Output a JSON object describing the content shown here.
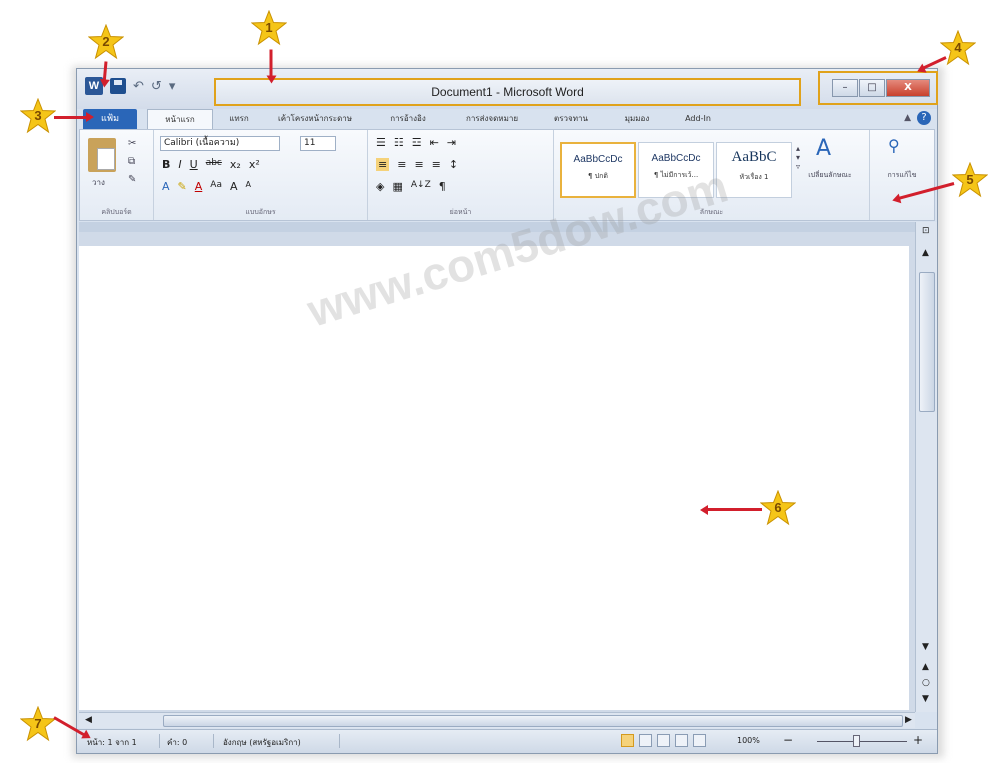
{
  "window": {
    "title": "Document1 - Microsoft Word",
    "app_icon_letter": "W",
    "controls": {
      "minimize": "–",
      "maximize": "□",
      "close": "X"
    }
  },
  "quick_access": {
    "undo": "↶",
    "redo": "↺",
    "customize": "▾"
  },
  "ribbon_tabs": {
    "file": "แฟ้ม",
    "tabs": [
      "หน้าแรก",
      "แทรก",
      "เค้าโครงหน้ากระดาษ",
      "การอ้างอิง",
      "การส่งจดหมาย",
      "ตรวจทาน",
      "มุมมอง",
      "Add-In"
    ],
    "active_index": 0
  },
  "ribbon": {
    "clipboard": {
      "paste_label": "วาง",
      "group_label": "คลิปบอร์ด"
    },
    "font": {
      "font_name": "Calibri (เนื้อความ)",
      "font_size": "11",
      "bold": "B",
      "italic": "I",
      "underline": "U",
      "strike": "abc",
      "subscript": "x₂",
      "superscript": "x²",
      "grow": "A",
      "shrink": "A",
      "case": "Aa",
      "group_label": "แบบอักษร"
    },
    "paragraph": {
      "sort": "A↓Z",
      "pilcrow": "¶",
      "group_label": "ย่อหน้า"
    },
    "styles": {
      "cards": [
        {
          "sample": "AaBbCcDc",
          "name": "¶ ปกติ"
        },
        {
          "sample": "AaBbCcDc",
          "name": "¶ ไม่มีการเว้..."
        },
        {
          "sample": "AaBbC",
          "name": "หัวเรื่อง 1"
        }
      ],
      "change_styles": "เปลี่ยนลักษณะ",
      "group_label": "ลักษณะ"
    },
    "editing": {
      "label": "การแก้ไข"
    }
  },
  "watermark": "www.com5dow.com",
  "status": {
    "page": "หน้า: 1 จาก 1",
    "words": "คำ: 0",
    "language": "อังกฤษ (สหรัฐอเมริกา)",
    "zoom": "100%",
    "zoom_out": "−",
    "zoom_in": "+"
  },
  "callouts": [
    "1",
    "2",
    "3",
    "4",
    "5",
    "6",
    "7"
  ],
  "colors": {
    "callout_fill": "#f5c518",
    "arrow": "#d21f2c",
    "highlight": "#e0a21b",
    "file_tab": "#2a66b8"
  }
}
